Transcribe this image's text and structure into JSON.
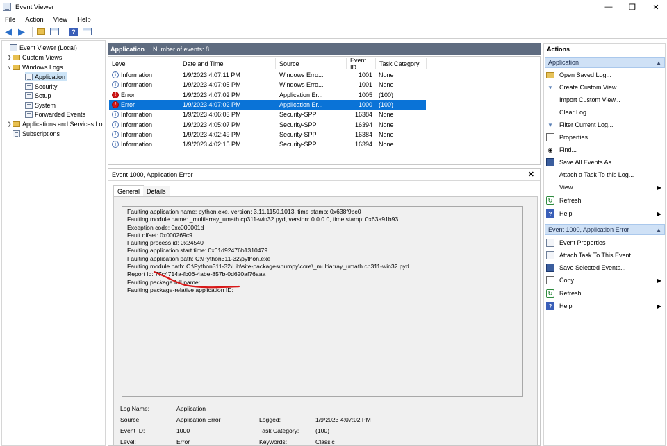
{
  "window": {
    "title": "Event Viewer",
    "minimize": "—",
    "maximize": "❒",
    "close": "✕"
  },
  "menu": [
    "File",
    "Action",
    "View",
    "Help"
  ],
  "tree": {
    "root": "Event Viewer (Local)",
    "custom_views": "Custom Views",
    "windows_logs": "Windows Logs",
    "application": "Application",
    "security": "Security",
    "setup": "Setup",
    "system": "System",
    "forwarded": "Forwarded Events",
    "apps_services": "Applications and Services Lo",
    "subscriptions": "Subscriptions"
  },
  "list": {
    "log_name": "Application",
    "count_label": "Number of events: 8",
    "columns": [
      "Level",
      "Date and Time",
      "Source",
      "Event ID",
      "Task Category"
    ],
    "rows": [
      {
        "level": "Information",
        "date": "1/9/2023 4:07:11 PM",
        "source": "Windows Erro...",
        "id": "1001",
        "category": "None",
        "type": "info"
      },
      {
        "level": "Information",
        "date": "1/9/2023 4:07:05 PM",
        "source": "Windows Erro...",
        "id": "1001",
        "category": "None",
        "type": "info"
      },
      {
        "level": "Error",
        "date": "1/9/2023 4:07:02 PM",
        "source": "Application Er...",
        "id": "1005",
        "category": "(100)",
        "type": "error"
      },
      {
        "level": "Error",
        "date": "1/9/2023 4:07:02 PM",
        "source": "Application Er...",
        "id": "1000",
        "category": "(100)",
        "type": "error",
        "selected": true
      },
      {
        "level": "Information",
        "date": "1/9/2023 4:06:03 PM",
        "source": "Security-SPP",
        "id": "16384",
        "category": "None",
        "type": "info"
      },
      {
        "level": "Information",
        "date": "1/9/2023 4:05:07 PM",
        "source": "Security-SPP",
        "id": "16394",
        "category": "None",
        "type": "info"
      },
      {
        "level": "Information",
        "date": "1/9/2023 4:02:49 PM",
        "source": "Security-SPP",
        "id": "16384",
        "category": "None",
        "type": "info"
      },
      {
        "level": "Information",
        "date": "1/9/2023 4:02:15 PM",
        "source": "Security-SPP",
        "id": "16394",
        "category": "None",
        "type": "info"
      }
    ]
  },
  "detail": {
    "title": "Event 1000, Application Error",
    "close": "✕",
    "tabs": [
      "General",
      "Details"
    ],
    "description": [
      "Faulting application name: python.exe, version: 3.11.1150.1013, time stamp: 0x638f9bc0",
      "Faulting module name: _multiarray_umath.cp311-win32.pyd, version: 0.0.0.0, time stamp: 0x63a91b93",
      "Exception code: 0xc000001d",
      "Fault offset: 0x000269c9",
      "Faulting process id: 0x24540",
      "Faulting application start time: 0x01d92476b1310479",
      "Faulting application path: C:\\Python311-32\\python.exe",
      "Faulting module path: C:\\Python311-32\\Lib\\site-packages\\numpy\\core\\_multiarray_umath.cp311-win32.pyd",
      "Report Id: 77c4714a-fb06-4abe-857b-0d620af76aaa",
      "Faulting package full name:",
      "Faulting package-relative application ID:"
    ],
    "props": {
      "log_name_label": "Log Name:",
      "log_name": "Application",
      "source_label": "Source:",
      "source": "Application Error",
      "logged_label": "Logged:",
      "logged": "1/9/2023 4:07:02 PM",
      "event_id_label": "Event ID:",
      "event_id": "1000",
      "task_label": "Task Category:",
      "task": "(100)",
      "level_label": "Level:",
      "level": "Error",
      "keywords_label": "Keywords:",
      "keywords": "Classic"
    }
  },
  "actions": {
    "header": "Actions",
    "section1": "Application",
    "items1": [
      "Open Saved Log...",
      "Create Custom View...",
      "Import Custom View...",
      "Clear Log...",
      "Filter Current Log...",
      "Properties",
      "Find...",
      "Save All Events As...",
      "Attach a Task To this Log...",
      "View",
      "Refresh",
      "Help"
    ],
    "section2": "Event 1000, Application Error",
    "items2": [
      "Event Properties",
      "Attach Task To This Event...",
      "Save Selected Events...",
      "Copy",
      "Refresh",
      "Help"
    ]
  },
  "accent": "#0a73d7"
}
